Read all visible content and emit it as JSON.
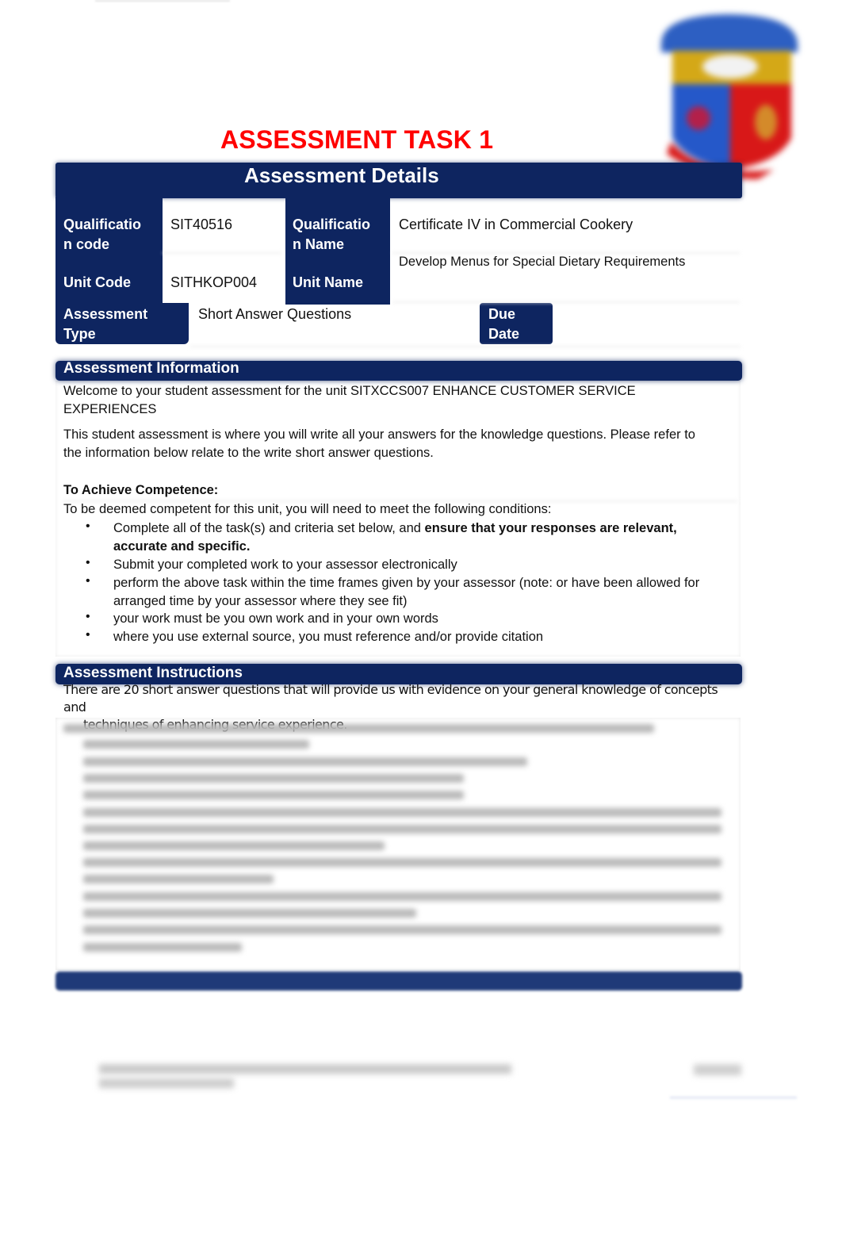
{
  "document": {
    "title": "ASSESSMENT TASK 1",
    "title_color": "#ff0000",
    "header_color": "#0e2560"
  },
  "logo": {
    "icon": "institution-crest-icon",
    "colors": [
      "#2d5fc2",
      "#d4a817",
      "#d81818"
    ]
  },
  "details": {
    "heading": "Assessment Details",
    "qualification_code_label_line1": "Qualificatio",
    "qualification_code_label_line2": "n code",
    "qualification_code": "SIT40516",
    "qualification_name_label_line1": "Qualificatio",
    "qualification_name_label_line2": "n Name",
    "qualification_name": "Certificate IV in Commercial Cookery",
    "unit_code_label": "Unit Code",
    "unit_code": "SITHKOP004",
    "unit_name_label": "Unit Name",
    "unit_name": "Develop Menus for Special Dietary Requirements",
    "assessment_type_label_line1": "Assessment",
    "assessment_type_label_line2": "Type",
    "assessment_type": "Short Answer Questions",
    "due_date_label_line1": "Due",
    "due_date_label_line2": "Date",
    "due_date": ""
  },
  "information": {
    "heading": "Assessment Information",
    "welcome_line1": "Welcome to your student assessment for the unit SITXCCS007 ENHANCE CUSTOMER SERVICE",
    "welcome_line2": "EXPERIENCES",
    "intro_line1": "This student assessment is where you will write all your answers for the knowledge questions. Please refer to",
    "intro_line2": "the information below relate to the write short answer questions.",
    "competence_heading": "To Achieve Competence:",
    "competence_intro": "To be deemed competent for this unit, you will need to meet the following conditions:",
    "bullets": [
      {
        "text": "Complete all of the task(s) and criteria set below, and ",
        "bold": "ensure that your responses are relevant,",
        "bold_line2": "accurate and specific."
      },
      {
        "text": "Submit your completed work to your assessor electronically"
      },
      {
        "text": "perform the above task within the time frames given by your assessor (note: or have been allowed for",
        "line2": "arranged time by your assessor where they see fit)"
      },
      {
        "text": "your work must be you own work and in your own words"
      },
      {
        "text": "where you use external source, you must reference and/or provide citation"
      }
    ],
    "bullet_glyph": "•"
  },
  "instructions": {
    "heading": "Assessment Instructions",
    "line1": "There are 20 short answer questions that will provide us with evidence on your general knowledge of concepts and",
    "line2": "techniques of enhancing service experience."
  }
}
